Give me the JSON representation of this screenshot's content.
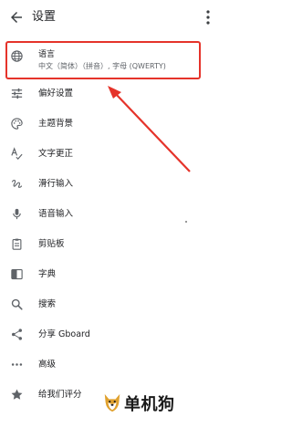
{
  "header": {
    "title": "设置"
  },
  "items": [
    {
      "label": "语言",
      "sub": "中文（简体）（拼音）, 字母 (QWERTY)",
      "icon": "globe-icon"
    },
    {
      "label": "偏好设置",
      "icon": "tune-icon"
    },
    {
      "label": "主题背景",
      "icon": "palette-icon"
    },
    {
      "label": "文字更正",
      "icon": "spellcheck-icon"
    },
    {
      "label": "滑行输入",
      "icon": "gesture-icon"
    },
    {
      "label": "语音输入",
      "icon": "mic-icon"
    },
    {
      "label": "剪贴板",
      "icon": "clipboard-icon"
    },
    {
      "label": "字典",
      "icon": "dictionary-icon"
    },
    {
      "label": "搜索",
      "icon": "search-icon"
    },
    {
      "label": "分享 Gboard",
      "icon": "share-icon"
    },
    {
      "label": "高级",
      "icon": "more-horiz-icon"
    },
    {
      "label": "给我们评分",
      "icon": "star-icon"
    }
  ],
  "watermark": {
    "text": "单机狗"
  },
  "colors": {
    "highlight": "#e5332a",
    "text": "#202124",
    "subtext": "#5f6368",
    "icon": "#5f6368"
  }
}
